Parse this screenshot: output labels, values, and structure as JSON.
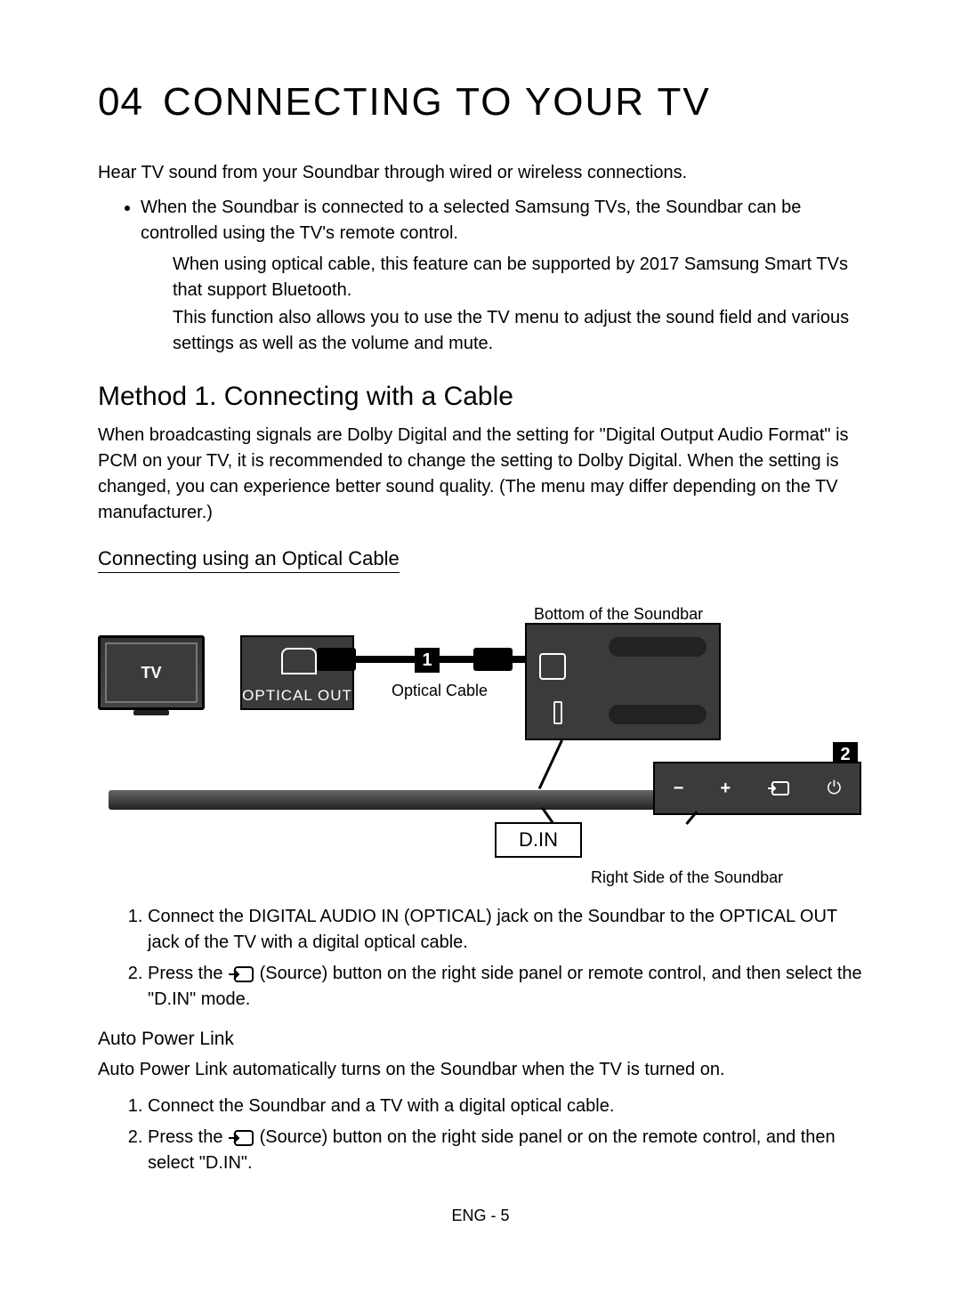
{
  "chapter": {
    "num": "04",
    "title": "CONNECTING TO YOUR TV"
  },
  "intro": "Hear TV sound from your Soundbar through wired or wireless connections.",
  "intro_bullet": "When the Soundbar is connected to a selected Samsung TVs, the Soundbar can be controlled using the TV's remote control.",
  "intro_sub1": "When using optical cable, this feature can be supported by 2017 Samsung Smart TVs that support Bluetooth.",
  "intro_sub2": "This function also allows you to use the TV menu to adjust the sound field and various settings as well as the volume and mute.",
  "method1": {
    "title": "Method 1. Connecting with a Cable",
    "desc": "When broadcasting signals are Dolby Digital and the setting for \"Digital Output Audio Format\" is PCM on your TV, it is recommended to change the setting to Dolby Digital. When the setting is changed, you can experience better sound quality. (The menu may differ depending on the TV manufacturer.)",
    "sub_title": "Connecting using an Optical Cable"
  },
  "diagram": {
    "top_caption": "Bottom of the Soundbar",
    "tv_label": "TV",
    "optical_out": "OPTICAL OUT",
    "optical_cable": "Optical Cable",
    "din": "D.IN",
    "right_caption": "Right Side of the Soundbar",
    "badge1": "1",
    "badge2": "2",
    "side_minus": "−",
    "side_plus": "+",
    "side_power": "⏻"
  },
  "steps1": {
    "s1": "Connect the DIGITAL AUDIO IN (OPTICAL) jack on the Soundbar to the OPTICAL OUT jack of the TV with a digital optical cable.",
    "s2a": "Press the ",
    "s2b": " (Source) button on the right side panel or remote control, and then select the \"D.IN\" mode."
  },
  "apl": {
    "title": "Auto Power Link",
    "desc": "Auto Power Link automatically turns on the Soundbar when the TV is turned on.",
    "s1": "Connect the Soundbar and a TV with a digital optical cable.",
    "s2a": "Press the ",
    "s2b": " (Source) button on the right side panel or on the remote control, and then select \"D.IN\"."
  },
  "footer": "ENG - 5"
}
